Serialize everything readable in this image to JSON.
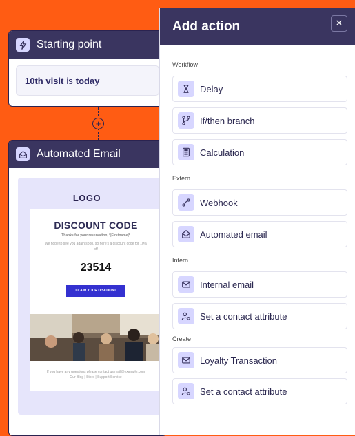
{
  "flow": {
    "starting_point": {
      "title": "Starting point",
      "trigger_prefix": "10th visit",
      "trigger_mid": "is",
      "trigger_suffix": "today"
    },
    "add_step_symbol": "+",
    "automated_email": {
      "title": "Automated Email",
      "preview": {
        "logo": "LOGO",
        "heading": "DISCOUNT CODE",
        "thanks": "Thanks for your reservation, *|Firstname|*",
        "message": "We hope to see you again soon, so here's a discount code for 10% off",
        "code": "23514",
        "cta": "CLAIM YOUR DISCOUNT",
        "footer_line1": "If you have any questions please contact us mail@example.com",
        "footer_line2": "Our Blog | Store | Support Service"
      }
    }
  },
  "panel": {
    "title": "Add action",
    "close_symbol": "✕",
    "sections": {
      "workflow": "Workflow",
      "extern": "Extern",
      "intern": "Intern",
      "create": "Create"
    },
    "items": {
      "delay": "Delay",
      "ifthen": "If/then branch",
      "calculation": "Calculation",
      "webhook": "Webhook",
      "automated_email": "Automated email",
      "internal_email": "Internal email",
      "contact_attr_1": "Set a contact attribute",
      "loyalty": "Loyalty Transaction",
      "contact_attr_2": "Set a contact attribute"
    }
  },
  "colors": {
    "background": "#ff5c13",
    "header": "#3a3560",
    "icon_bg": "#d7d6ff",
    "cta": "#3431d0"
  }
}
